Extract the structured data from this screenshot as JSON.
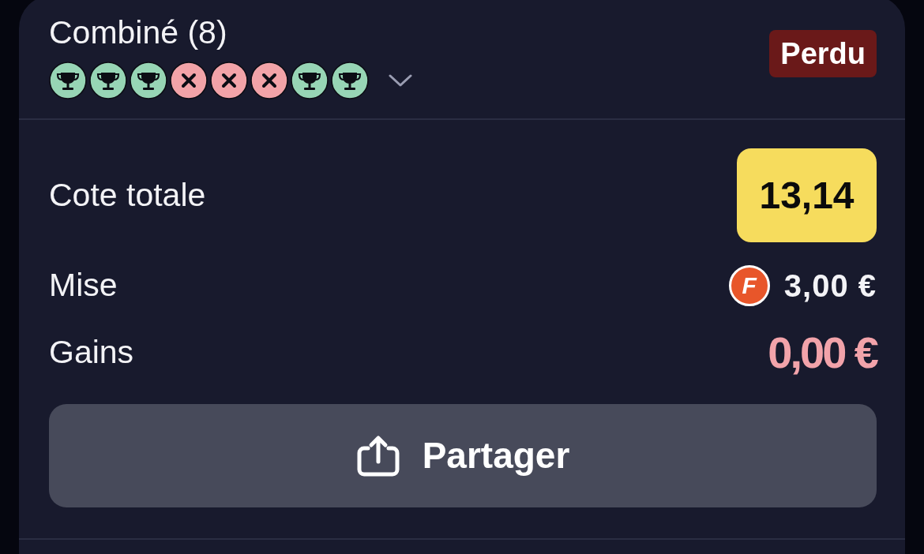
{
  "bet": {
    "title": "Combiné (8)",
    "legs": [
      {
        "won": true
      },
      {
        "won": true
      },
      {
        "won": true
      },
      {
        "won": false
      },
      {
        "won": false
      },
      {
        "won": false
      },
      {
        "won": true
      },
      {
        "won": true
      }
    ],
    "expanded": false,
    "status": "Perdu"
  },
  "summary": {
    "total_odds": {
      "label": "Cote totale",
      "value": "13,14"
    },
    "stake": {
      "label": "Mise",
      "coin": "F",
      "value": "3,00 €"
    },
    "winnings": {
      "label": "Gains",
      "value": "0,00 €"
    }
  },
  "share_button": {
    "label": "Partager"
  }
}
